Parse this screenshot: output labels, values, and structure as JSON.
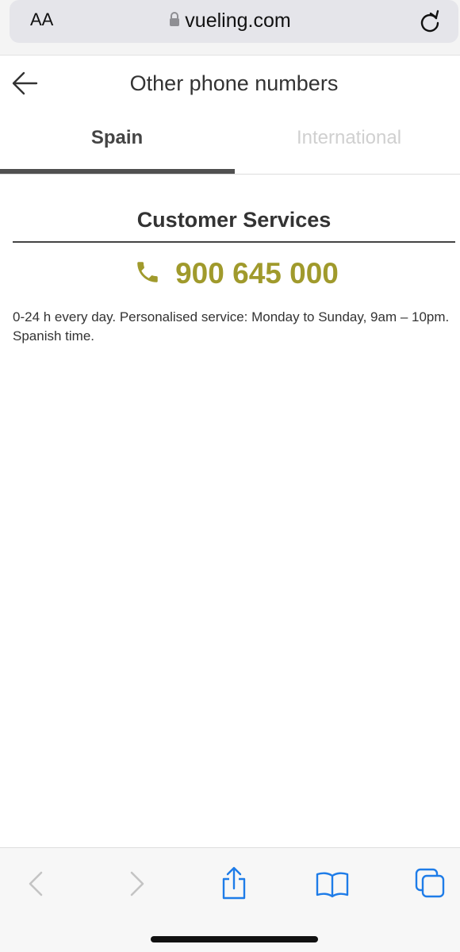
{
  "browser": {
    "text_size_label": "AA",
    "url": "vueling.com"
  },
  "header": {
    "title": "Other phone numbers"
  },
  "tabs": [
    {
      "label": "Spain",
      "selected": true
    },
    {
      "label": "International",
      "selected": false
    }
  ],
  "content": {
    "section_title": "Customer Services",
    "phone_number": "900 645 000",
    "hours": "0-24 h every day. Personalised service: Monday to Sunday, 9am – 10pm. Spanish time."
  },
  "colors": {
    "accent": "#a09a2c",
    "link_blue": "#1e7ce8",
    "disabled_gray": "#c4c4c4"
  },
  "icons": {
    "back": "arrow-left-icon",
    "lock": "lock-icon",
    "reload": "reload-icon",
    "phone": "phone-icon",
    "nav_back": "chevron-left-icon",
    "nav_forward": "chevron-right-icon",
    "share": "share-icon",
    "bookmarks": "book-icon",
    "tabs": "tabs-icon"
  }
}
